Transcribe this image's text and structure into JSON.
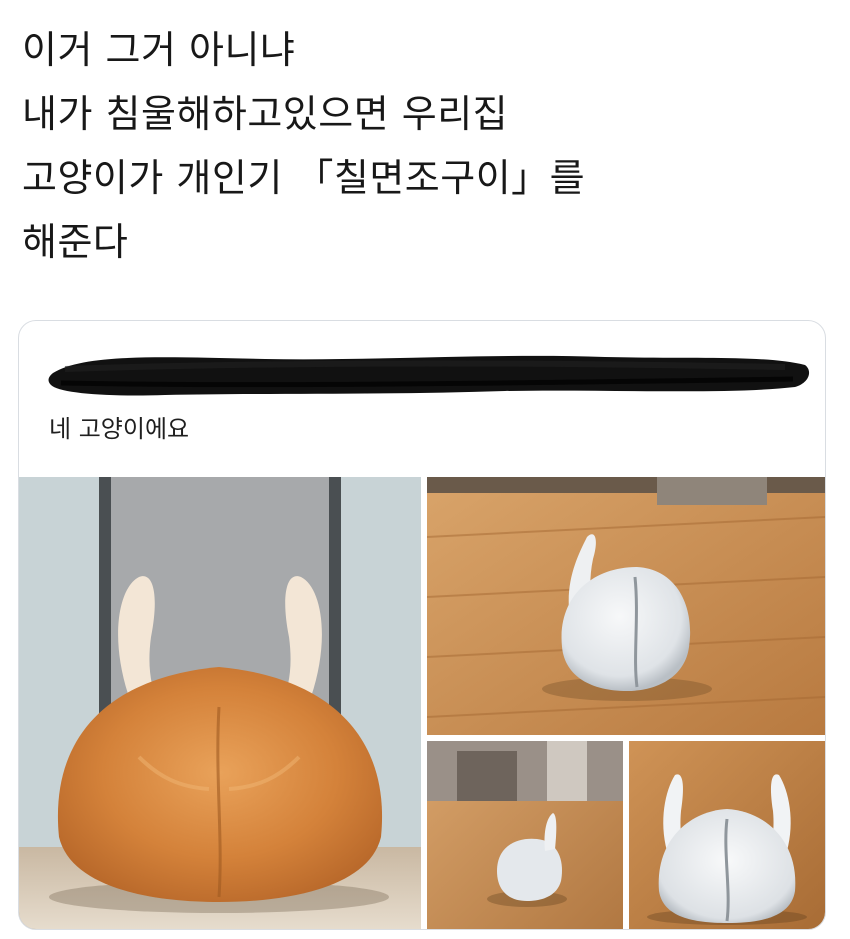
{
  "post": {
    "lines": [
      "이거 그거 아니냐",
      "내가 침울해하고있으면 우리집",
      "고양이가 개인기 「칠면조구이」를",
      "해준다"
    ]
  },
  "quoted_card": {
    "caption": "네 고양이에요",
    "photos": [
      {
        "icon": "orange-cat-turkey-pose-photo"
      },
      {
        "icon": "white-cat-loaf-on-floor-photo"
      },
      {
        "icon": "white-cat-side-small-photo"
      },
      {
        "icon": "white-cat-turkey-pose-photo"
      }
    ]
  },
  "colors": {
    "text": "#181818",
    "card_border": "#d9dde2",
    "redaction": "#111111",
    "orange_cat": "#d98a3e",
    "white_cat": "#e9ecef",
    "wood_floor": "#c98a4f"
  }
}
